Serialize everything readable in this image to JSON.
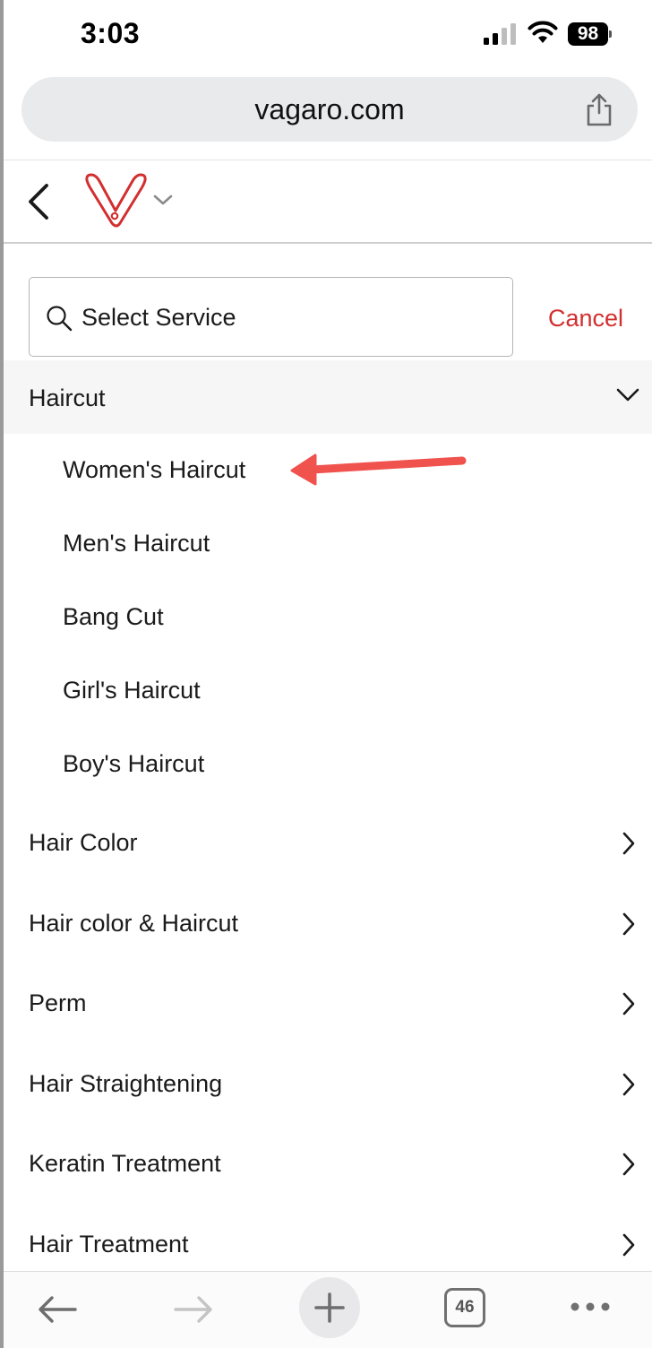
{
  "status_bar": {
    "time": "3:03",
    "battery": "98"
  },
  "browser": {
    "url": "vagaro.com",
    "open_tabs_count": "46"
  },
  "search": {
    "placeholder": "Select Service",
    "cancel_label": "Cancel"
  },
  "expanded_category": {
    "label": "Haircut",
    "items": [
      {
        "label": "Women's Haircut"
      },
      {
        "label": "Men's Haircut"
      },
      {
        "label": "Bang Cut"
      },
      {
        "label": "Girl's Haircut"
      },
      {
        "label": "Boy's Haircut"
      }
    ]
  },
  "categories": [
    {
      "label": "Hair Color"
    },
    {
      "label": "Hair color & Haircut"
    },
    {
      "label": "Perm"
    },
    {
      "label": "Hair Straightening"
    },
    {
      "label": "Keratin Treatment"
    },
    {
      "label": "Hair Treatment"
    }
  ],
  "colors": {
    "brand_red": "#d22f2f",
    "annotation_arrow": "#f0524e",
    "expanded_bg": "#f6f6f6"
  },
  "icons": {
    "back": "chevron-left-icon",
    "logo": "vagaro-logo",
    "search": "search-icon",
    "expand": "chevron-down-icon",
    "collapse": "chevron-right-icon",
    "share": "share-icon"
  }
}
